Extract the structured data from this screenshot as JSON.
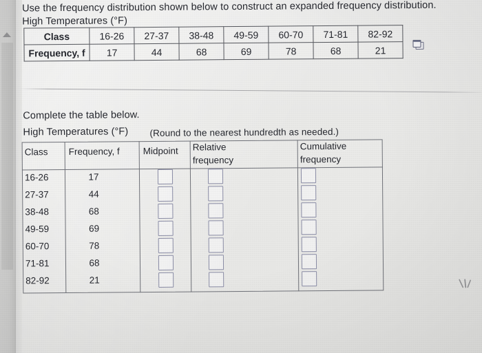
{
  "question": {
    "prompt": "Use the frequency distribution shown below to construct an expanded frequency distribution.",
    "table_title": "High Temperatures (°F)"
  },
  "freq_table": {
    "row_headers": [
      "Class",
      "Frequency, f"
    ],
    "classes": [
      "16-26",
      "27-37",
      "38-48",
      "49-59",
      "60-70",
      "71-81",
      "82-92"
    ],
    "frequencies": [
      "17",
      "44",
      "68",
      "69",
      "78",
      "68",
      "21"
    ]
  },
  "instructions": {
    "complete": "Complete the table below.",
    "table_title": "High Temperatures (°F)",
    "rounding_note": "(Round to the nearest hundredth as needed.)"
  },
  "answer_table": {
    "headers": {
      "class": "Class",
      "frequency": "Frequency, f",
      "midpoint": "Midpoint",
      "relative_frequency_line1": "Relative",
      "relative_frequency_line2": "frequency",
      "cumulative_frequency_line1": "Cumulative",
      "cumulative_frequency_line2": "frequency"
    },
    "rows": [
      {
        "class": "16-26",
        "frequency": "17",
        "midpoint": "",
        "relative_frequency": "",
        "cumulative_frequency": ""
      },
      {
        "class": "27-37",
        "frequency": "44",
        "midpoint": "",
        "relative_frequency": "",
        "cumulative_frequency": ""
      },
      {
        "class": "38-48",
        "frequency": "68",
        "midpoint": "",
        "relative_frequency": "",
        "cumulative_frequency": ""
      },
      {
        "class": "49-59",
        "frequency": "69",
        "midpoint": "",
        "relative_frequency": "",
        "cumulative_frequency": ""
      },
      {
        "class": "60-70",
        "frequency": "78",
        "midpoint": "",
        "relative_frequency": "",
        "cumulative_frequency": ""
      },
      {
        "class": "71-81",
        "frequency": "68",
        "midpoint": "",
        "relative_frequency": "",
        "cumulative_frequency": ""
      },
      {
        "class": "82-92",
        "frequency": "21",
        "midpoint": "",
        "relative_frequency": "",
        "cumulative_frequency": ""
      }
    ]
  },
  "icons": {
    "copy": "copy-icon",
    "scroll_up": "scroll-up-arrow-icon"
  },
  "colors": {
    "page_background": "#e8e8e6",
    "text": "#26282f",
    "table_border": "#55575d",
    "input_border": "#8b8da6",
    "scrollbar": "#c7c7c6"
  }
}
